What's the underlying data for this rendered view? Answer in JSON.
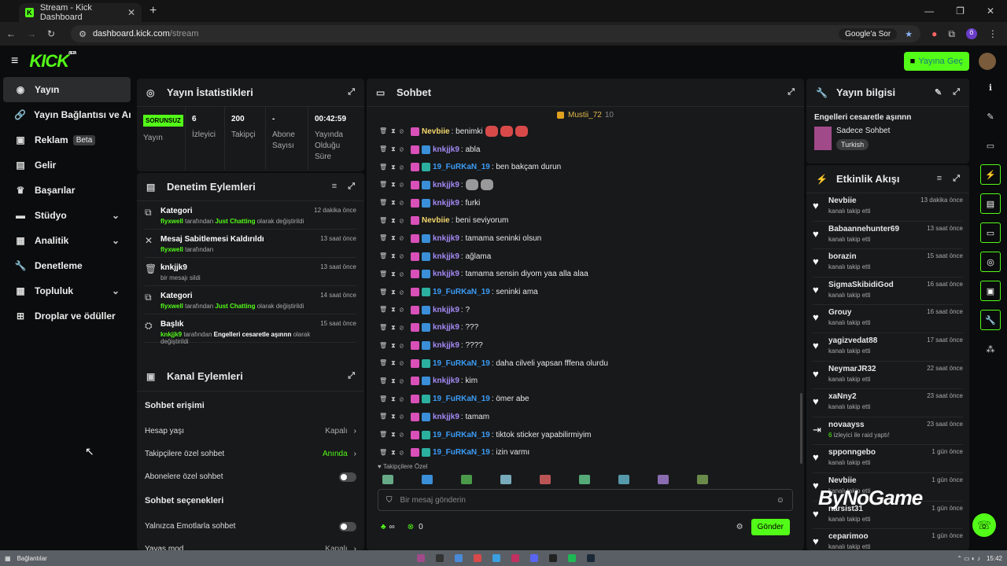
{
  "browser": {
    "tab_title": "Stream - Kick Dashboard",
    "url_host": "dashboard.kick.com",
    "url_path": "/stream",
    "google_label": "Google'a Sor",
    "profile": "ö"
  },
  "header": {
    "logo": "KICK",
    "beta": "BETA",
    "go_live": "Yayına Geç"
  },
  "sidebar": {
    "items": [
      {
        "label": "Yayın",
        "icon": "radio-icon",
        "active": true
      },
      {
        "label": "Yayın Bağlantısı ve Anahtarı",
        "icon": "link-icon"
      },
      {
        "label": "Reklam",
        "icon": "ad-icon",
        "badge": "Beta"
      },
      {
        "label": "Gelir",
        "icon": "money-icon"
      },
      {
        "label": "Başarılar",
        "icon": "trophy-icon"
      },
      {
        "label": "Stüdyo",
        "icon": "studio-icon",
        "chevron": true
      },
      {
        "label": "Analitik",
        "icon": "chart-icon",
        "chevron": true
      },
      {
        "label": "Denetleme",
        "icon": "wrench-icon"
      },
      {
        "label": "Topluluk",
        "icon": "community-icon",
        "chevron": true
      },
      {
        "label": "Droplar ve ödüller",
        "icon": "gift-icon"
      }
    ]
  },
  "stats": {
    "title": "Yayın İstatistikleri",
    "status": "SORUNSUZ",
    "status_label": "Yayın",
    "items": [
      {
        "value": "6",
        "label": "İzleyici"
      },
      {
        "value": "200",
        "label": "Takipçi"
      },
      {
        "value": "-",
        "label": "Abone Sayısı"
      },
      {
        "value": "00:42:59",
        "label": "Yayında Olduğu Süre"
      }
    ]
  },
  "moderation": {
    "title": "Denetim Eylemleri",
    "items": [
      {
        "title": "Kategori",
        "actor": "flyxwell",
        "mid": " tarafından ",
        "target": "Just Chatting",
        "end": " olarak değiştirildi",
        "time": "12 dakika önce"
      },
      {
        "title": "Mesaj Sabitlemesi Kaldırıldı",
        "actor": "flyxwell",
        "mid": " tarafından",
        "target": "",
        "end": "",
        "time": "13 saat önce"
      },
      {
        "title": "knkjjk9",
        "actor": "",
        "mid": "bir mesajı sildi",
        "target": "",
        "end": "",
        "time": "13 saat önce"
      },
      {
        "title": "Kategori",
        "actor": "flyxwell",
        "mid": " tarafından ",
        "target": "Just Chatting",
        "end": " olarak değiştirildi",
        "time": "14 saat önce"
      },
      {
        "title": "Başlık",
        "actor": "knkjjk9",
        "mid": " tarafından ",
        "target": "Engelleri cesaretle aşınnn",
        "end": " olarak değiştirildi",
        "time": "15 saat önce"
      }
    ]
  },
  "channel": {
    "title": "Kanal Eylemleri",
    "access_title": "Sohbet erişimi",
    "options_title": "Sohbet seçenekleri",
    "rows": [
      {
        "label": "Hesap yaşı",
        "value": "Kapalı"
      },
      {
        "label": "Takipçilere özel sohbet",
        "value": "Anında"
      }
    ],
    "toggles": [
      "Abonelere özel sohbet"
    ],
    "opt_toggles": [
      "Yalnızca Emotlarla sohbet"
    ],
    "last": {
      "label": "Yavaş mod",
      "value": "Kapalı"
    }
  },
  "chat": {
    "title": "Sohbet",
    "pinned_user": "Mustii_72",
    "pinned_count": "10",
    "messages": [
      {
        "user": "Nevbiie",
        "text": ": benimki",
        "color": "#f5d76e",
        "emotes": 3
      },
      {
        "user": "knkjjk9",
        "text": ": abla",
        "color": "#a48af5"
      },
      {
        "user": "19_FuRKaN_19",
        "text": ": ben bakçam durun",
        "color": "#3b9cf5"
      },
      {
        "user": "knkjjk9",
        "text": ": ",
        "color": "#a48af5",
        "emotes": 2
      },
      {
        "user": "knkjjk9",
        "text": ": furki",
        "color": "#a48af5"
      },
      {
        "user": "Nevbiie",
        "text": ": beni seviyorum",
        "color": "#f5d76e"
      },
      {
        "user": "knkjjk9",
        "text": ": tamama seninki olsun",
        "color": "#a48af5"
      },
      {
        "user": "knkjjk9",
        "text": ": ağlama",
        "color": "#a48af5"
      },
      {
        "user": "knkjjk9",
        "text": ": tamama sensin diyom yaa alla alaa",
        "color": "#a48af5"
      },
      {
        "user": "19_FuRKaN_19",
        "text": ": seninki ama",
        "color": "#3b9cf5"
      },
      {
        "user": "knkjjk9",
        "text": ": ?",
        "color": "#a48af5"
      },
      {
        "user": "knkjjk9",
        "text": ": ???",
        "color": "#a48af5"
      },
      {
        "user": "knkjjk9",
        "text": ": ????",
        "color": "#a48af5"
      },
      {
        "user": "19_FuRKaN_19",
        "text": ": daha cilveli yapsan fffena olurdu",
        "color": "#3b9cf5"
      },
      {
        "user": "knkjjk9",
        "text": ": kim",
        "color": "#a48af5"
      },
      {
        "user": "19_FuRKaN_19",
        "text": ": ömer abe",
        "color": "#3b9cf5"
      },
      {
        "user": "knkjjk9",
        "text": ": tamam",
        "color": "#a48af5"
      },
      {
        "user": "19_FuRKaN_19",
        "text": ": tiktok sticker yapabilirmiyim",
        "color": "#3b9cf5"
      },
      {
        "user": "19_FuRKaN_19",
        "text": ": izin varmı",
        "color": "#3b9cf5"
      }
    ],
    "follow_only": "Takipçilere Özel",
    "placeholder": "Bir mesaj gönderin",
    "points": "0",
    "send": "Gönder"
  },
  "info": {
    "title": "Yayın bilgisi",
    "stream_title": "Engelleri cesaretle aşınnn",
    "category": "Sadece Sohbet",
    "tag": "Turkish"
  },
  "activity": {
    "title": "Etkinlik Akışı",
    "items": [
      {
        "name": "Nevbiie",
        "desc": "kanalı takip etti",
        "time": "13 dakika önce"
      },
      {
        "name": "Babaannehunter69",
        "desc": "kanalı takip etti",
        "time": "13 saat önce"
      },
      {
        "name": "borazin",
        "desc": "kanalı takip etti",
        "time": "15 saat önce"
      },
      {
        "name": "SigmaSkibidiGod",
        "desc": "kanalı takip etti",
        "time": "16 saat önce"
      },
      {
        "name": "Grouy",
        "desc": "kanalı takip etti",
        "time": "16 saat önce"
      },
      {
        "name": "yagizvedat88",
        "desc": "kanalı takip etti",
        "time": "17 saat önce"
      },
      {
        "name": "NeymarJR32",
        "desc": "kanalı takip etti",
        "time": "22 saat önce"
      },
      {
        "name": "xaNny2",
        "desc": "kanalı takip etti",
        "time": "23 saat önce"
      },
      {
        "name": "novaayss",
        "desc_num": "6",
        "desc": " izleyici ile raid yaptı!",
        "time": "23 saat önce",
        "raid": true
      },
      {
        "name": "spponngebo",
        "desc": "kanalı takip etti",
        "time": "1 gün önce"
      },
      {
        "name": "Nevbiie",
        "desc": "kanalı takip etti",
        "time": "1 gün önce"
      },
      {
        "name": "narsist31",
        "desc": "kanalı takip etti",
        "time": "1 gün önce"
      },
      {
        "name": "ceparimoo",
        "desc": "kanalı takip etti",
        "time": "1 gün önce"
      }
    ]
  },
  "watermark": "ByNoGame",
  "taskbar": {
    "label": "Bağlantılar",
    "time": "15:42"
  }
}
